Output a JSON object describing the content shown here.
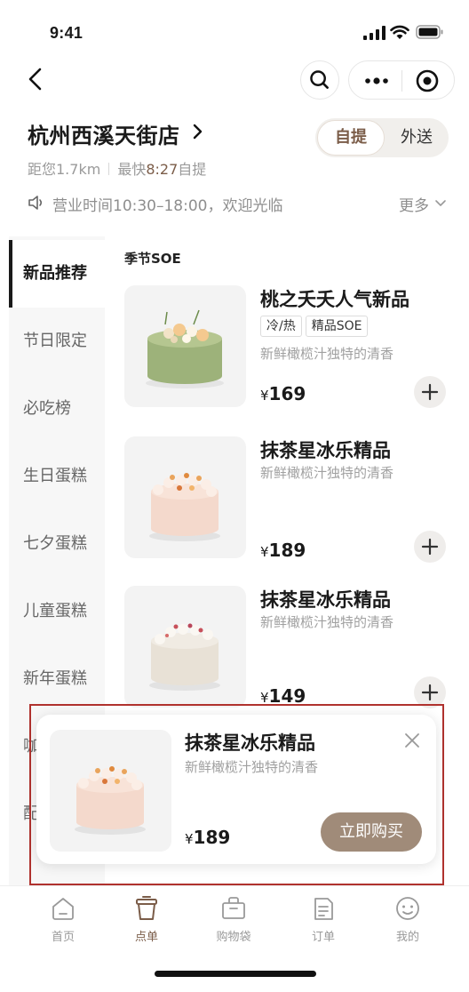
{
  "status_bar": {
    "time": "9:41"
  },
  "store": {
    "name": "杭州西溪天街店",
    "distance": "距您1.7km",
    "eta_prefix": "最快",
    "eta_time": "8:27",
    "eta_suffix": "自提",
    "mode_pickup": "自提",
    "mode_delivery": "外送",
    "notice": "营业时间10:30–18:00，欢迎光临",
    "notice_more": "更多"
  },
  "sidebar": {
    "items": [
      {
        "label": "新品推荐"
      },
      {
        "label": "节日限定"
      },
      {
        "label": "必吃榜"
      },
      {
        "label": "生日蛋糕"
      },
      {
        "label": "七夕蛋糕"
      },
      {
        "label": "儿童蛋糕"
      },
      {
        "label": "新年蛋糕"
      },
      {
        "label": "咖"
      },
      {
        "label": "配"
      }
    ],
    "active_index": 0
  },
  "menu": {
    "section_title": "季节SOE",
    "products": [
      {
        "name": "桃之夭夭人气新品",
        "tags": [
          "冷/热",
          "精品SOE"
        ],
        "desc": "新鲜橄榄汁独特的清香",
        "currency": "¥",
        "price": "169"
      },
      {
        "name": "抹茶星冰乐精品",
        "tags": [],
        "desc": "新鲜橄榄汁独特的清香",
        "currency": "¥",
        "price": "189"
      },
      {
        "name": "抹茶星冰乐精品",
        "tags": [],
        "desc": "新鲜橄榄汁独特的清香",
        "currency": "¥",
        "price": "149"
      }
    ]
  },
  "popup": {
    "name": "抹茶星冰乐精品",
    "desc": "新鲜橄榄汁独特的清香",
    "currency": "¥",
    "price": "189",
    "buy_label": "立即购买"
  },
  "tabbar": {
    "items": [
      {
        "label": "首页",
        "icon": "home-icon"
      },
      {
        "label": "点单",
        "icon": "cup-icon"
      },
      {
        "label": "购物袋",
        "icon": "bag-icon"
      },
      {
        "label": "订单",
        "icon": "order-icon"
      },
      {
        "label": "我的",
        "icon": "profile-icon"
      }
    ],
    "active_index": 1
  },
  "colors": {
    "accent_brown": "#7b5d49",
    "buy_button": "#a08b79",
    "matcha_cake": "#9db27a",
    "pink_cake": "#f4d9cc",
    "highlight_border": "#b0322e"
  }
}
